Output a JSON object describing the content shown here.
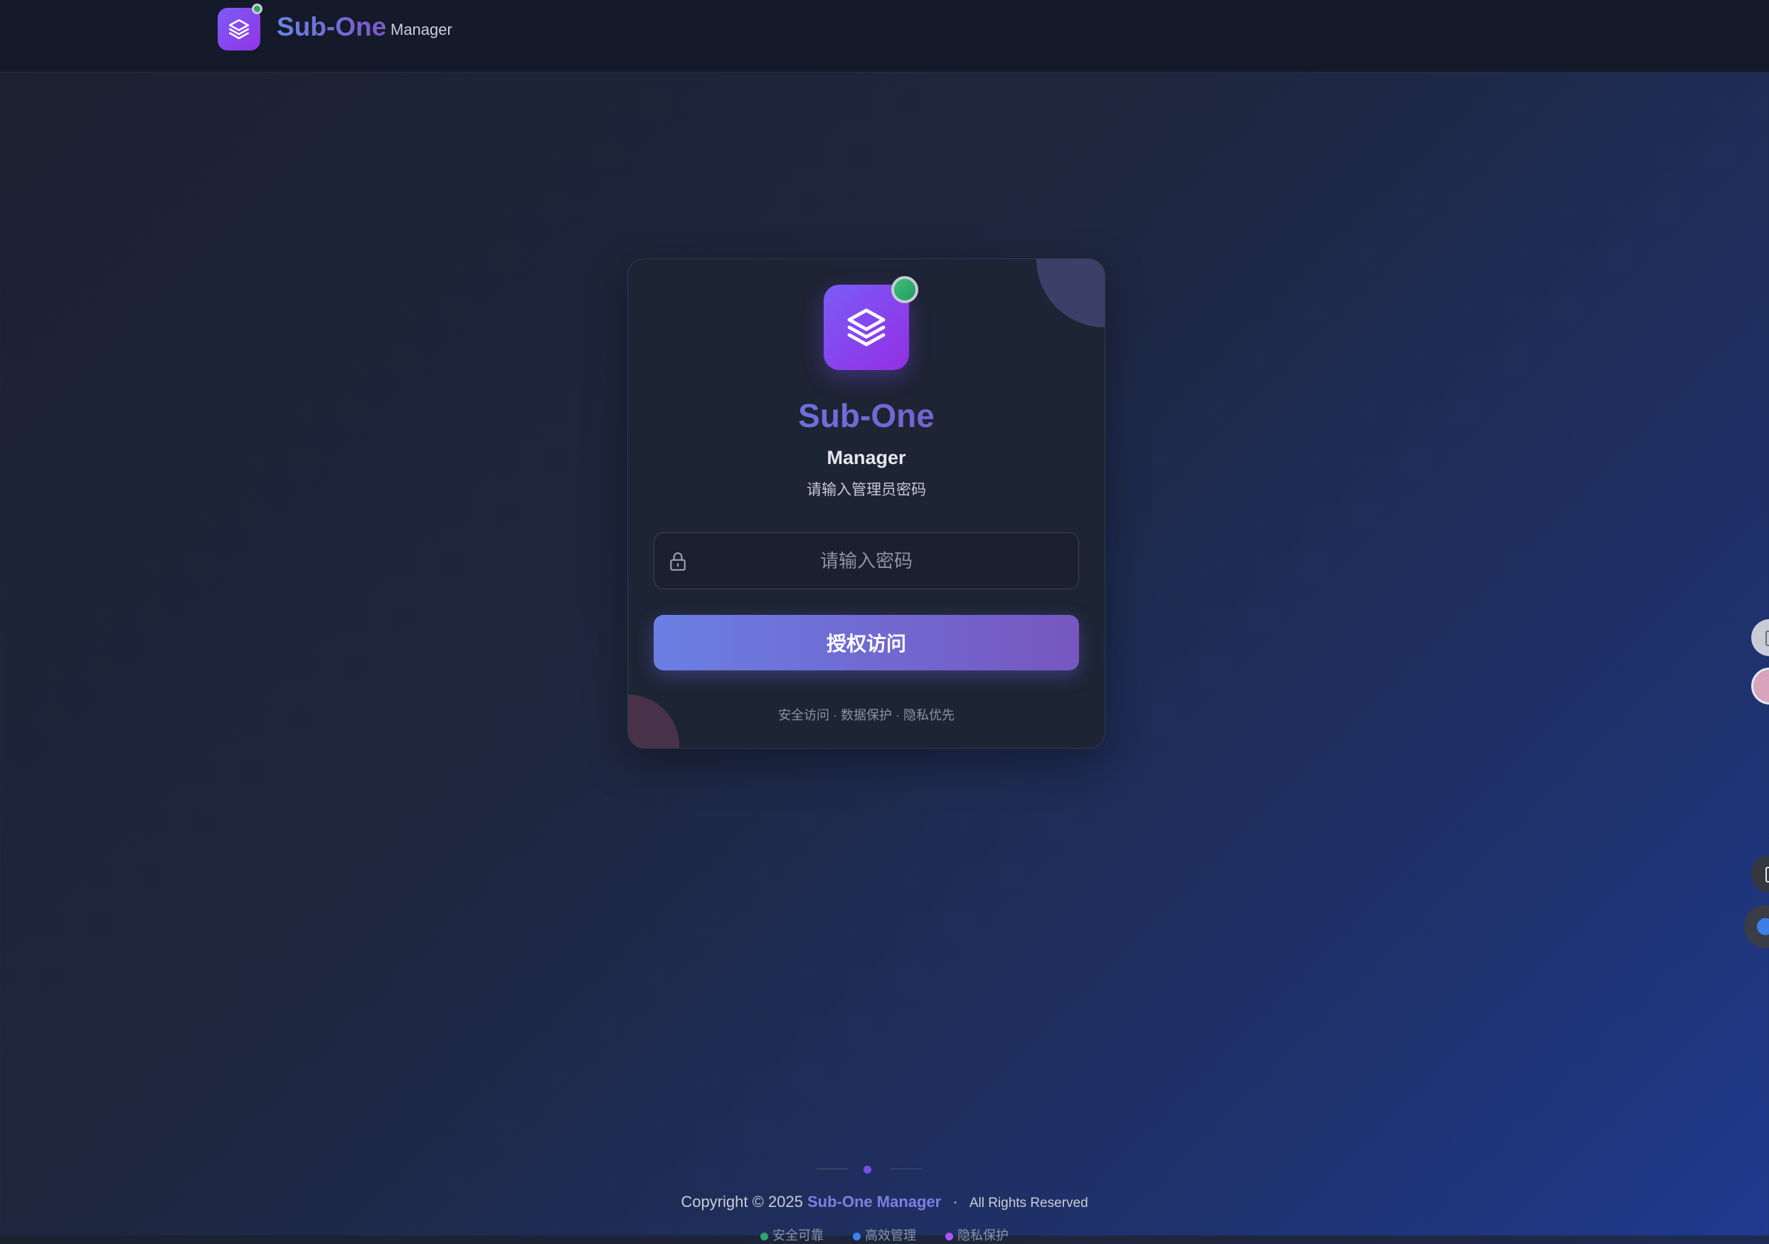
{
  "header": {
    "app_name": "Sub-One",
    "app_sub": "Manager"
  },
  "login": {
    "title": "Sub-One",
    "subtitle": "Manager",
    "hint": "请输入管理员密码",
    "password_placeholder": "请输入密码",
    "password_value": "",
    "submit_label": "授权访问",
    "footer_text": "安全访问 · 数据保护 · 隐私优先"
  },
  "footer": {
    "copyright_prefix": "Copyright © 2025",
    "brand": "Sub-One Manager",
    "separator": "·",
    "rights": "All Rights Reserved",
    "features": [
      {
        "label": "安全可靠",
        "color": "#2fa56b"
      },
      {
        "label": "高效管理",
        "color": "#3b82f6"
      },
      {
        "label": "隐私保护",
        "color": "#a855f7"
      }
    ]
  },
  "icons": {
    "app_logo": "layers-icon",
    "lock": "lock-icon",
    "status": "online-status-dot"
  },
  "colors": {
    "accent_start": "#6a7fe4",
    "accent_end": "#7756c0",
    "logo_start": "#7a5cf6",
    "logo_end": "#932fe4",
    "status_online": "#2fa56b"
  }
}
